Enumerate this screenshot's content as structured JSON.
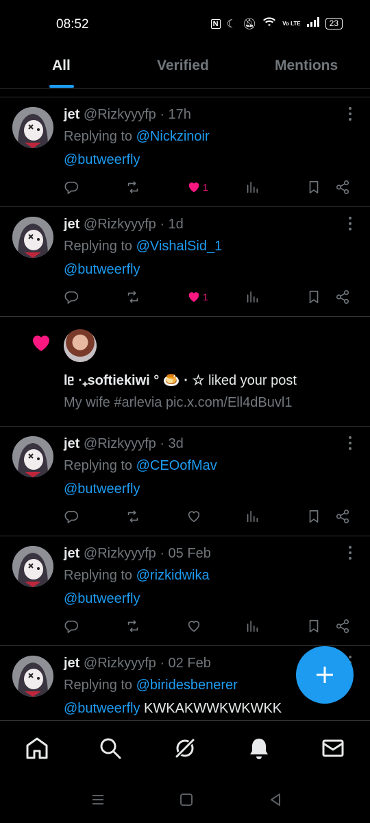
{
  "status_bar": {
    "time": "08:52",
    "battery": "23",
    "network": "Vo LTE"
  },
  "tabs": [
    {
      "label": "All",
      "active": true
    },
    {
      "label": "Verified",
      "active": false
    },
    {
      "label": "Mentions",
      "active": false
    }
  ],
  "feed": [
    {
      "type": "reply",
      "name": "jet",
      "handle": "@Rizkyyyfp",
      "time": "· 17h",
      "replying_prefix": "Replying to ",
      "replying_to": "@Nickzinoir",
      "mention": "@butweerfly",
      "extra_text": "",
      "liked": true,
      "like_count": "1"
    },
    {
      "type": "reply",
      "name": "jet",
      "handle": "@Rizkyyyfp",
      "time": "· 1d",
      "replying_prefix": "Replying to ",
      "replying_to": "@VishalSid_1",
      "mention": "@butweerfly",
      "extra_text": "",
      "liked": true,
      "like_count": "1"
    },
    {
      "type": "like",
      "actor_name": "lᥱ ·₊softiekiwi ° 🍮 · ☆",
      "action": " liked your post",
      "preview": "My wife #arlevia pic.x.com/Ell4dBuvl1"
    },
    {
      "type": "reply",
      "name": "jet",
      "handle": "@Rizkyyyfp",
      "time": "· 3d",
      "replying_prefix": "Replying to ",
      "replying_to": "@CEOofMav",
      "mention": "@butweerfly",
      "extra_text": "",
      "liked": false,
      "like_count": ""
    },
    {
      "type": "reply",
      "name": "jet",
      "handle": "@Rizkyyyfp",
      "time": "· 05 Feb",
      "replying_prefix": "Replying to ",
      "replying_to": "@rizkidwika",
      "mention": "@butweerfly",
      "extra_text": "",
      "liked": false,
      "like_count": ""
    },
    {
      "type": "reply",
      "name": "jet",
      "handle": "@Rizkyyyfp",
      "time": "· 02 Feb",
      "replying_prefix": "Replying to ",
      "replying_to": "@biridesbenerer",
      "mention": "@butweerfly",
      "extra_text": " KWKAKWWKWKWKK",
      "liked": false,
      "like_count": ""
    }
  ],
  "bottom_nav": [
    "home-icon",
    "search-icon",
    "grok-icon",
    "notifications-bell-icon",
    "messages-mail-icon"
  ],
  "colors": {
    "accent": "#1d9bf0",
    "like": "#f91880",
    "muted": "#71767b",
    "divider": "#2f3336"
  }
}
